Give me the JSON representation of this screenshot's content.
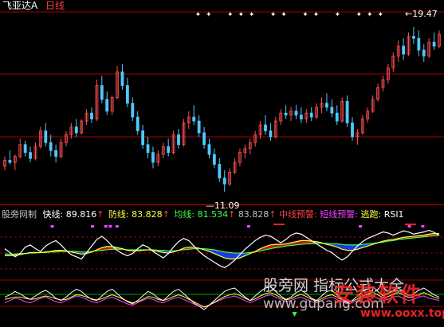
{
  "header": {
    "title": "飞亚达A",
    "period": "日线"
  },
  "price_labels": {
    "high": "19.47",
    "low": "11.09"
  },
  "indicator": {
    "name": "股旁网制",
    "fast_label": "快线:",
    "fast_value": "89.816",
    "defense_label": "防线:",
    "defense_value": "83.828",
    "mean_label": "均线:",
    "mean_value": "81.534",
    "extra_value": "83.828",
    "mid_warn": "中线预警:",
    "short_warn": "短线预警:",
    "escape": "逃跑:",
    "rsi": "RSI1"
  },
  "watermark": {
    "text1": "股旁网 指标公式大全",
    "text2": "www.gupang.com",
    "text3": "安装软件",
    "text4": "www.ooxx.top"
  },
  "colors": {
    "up": "#ff5050",
    "down": "#50c8ff",
    "fast": "#ffffff",
    "defense": "#ffff40",
    "mean": "#40ff40",
    "red_fill": "#d02020",
    "blue_fill": "#2040ff",
    "magenta": "#ff40ff",
    "axis_red": "#a00000"
  },
  "chart_data": {
    "type": "candlestick",
    "ylim": [
      10.5,
      20.2
    ],
    "high_label_value": 19.47,
    "low_label_value": 11.09,
    "candles": [
      [
        12.4,
        12.9,
        12.2,
        12.7
      ],
      [
        12.7,
        13.2,
        12.5,
        12.6
      ],
      [
        12.6,
        13.0,
        12.2,
        12.9
      ],
      [
        12.9,
        13.8,
        12.8,
        13.5
      ],
      [
        13.5,
        13.7,
        12.9,
        13.1
      ],
      [
        13.1,
        13.4,
        12.6,
        12.8
      ],
      [
        12.8,
        13.6,
        12.7,
        13.4
      ],
      [
        13.4,
        14.4,
        13.3,
        14.2
      ],
      [
        14.2,
        14.6,
        13.4,
        13.6
      ],
      [
        13.6,
        14.0,
        12.9,
        13.2
      ],
      [
        13.2,
        13.5,
        12.6,
        12.9
      ],
      [
        12.9,
        13.8,
        12.8,
        13.6
      ],
      [
        13.6,
        14.2,
        13.4,
        14.0
      ],
      [
        14.0,
        14.6,
        13.8,
        14.4
      ],
      [
        14.4,
        14.8,
        13.9,
        14.1
      ],
      [
        14.1,
        14.8,
        14.0,
        14.7
      ],
      [
        14.7,
        15.3,
        14.5,
        15.1
      ],
      [
        15.1,
        15.4,
        14.6,
        14.8
      ],
      [
        14.8,
        16.8,
        14.7,
        16.5
      ],
      [
        16.5,
        17.0,
        15.6,
        15.8
      ],
      [
        15.8,
        16.2,
        15.0,
        15.2
      ],
      [
        15.2,
        16.0,
        15.0,
        15.9
      ],
      [
        15.9,
        17.5,
        15.8,
        17.2
      ],
      [
        17.2,
        17.6,
        16.3,
        16.5
      ],
      [
        16.5,
        16.9,
        15.4,
        15.6
      ],
      [
        15.6,
        15.9,
        14.7,
        14.9
      ],
      [
        14.9,
        15.2,
        14.0,
        14.2
      ],
      [
        14.2,
        14.5,
        13.3,
        13.5
      ],
      [
        13.5,
        13.9,
        12.8,
        13.1
      ],
      [
        13.1,
        13.4,
        12.3,
        12.6
      ],
      [
        12.6,
        13.2,
        12.4,
        13.0
      ],
      [
        13.0,
        13.6,
        12.8,
        13.4
      ],
      [
        13.4,
        13.8,
        12.9,
        13.1
      ],
      [
        13.1,
        14.2,
        13.0,
        14.0
      ],
      [
        14.0,
        14.3,
        13.3,
        13.5
      ],
      [
        13.5,
        14.8,
        13.4,
        14.6
      ],
      [
        14.6,
        15.2,
        14.3,
        14.9
      ],
      [
        14.9,
        15.5,
        14.5,
        14.7
      ],
      [
        14.7,
        15.0,
        13.9,
        14.1
      ],
      [
        14.1,
        14.4,
        13.3,
        13.5
      ],
      [
        13.5,
        13.8,
        12.8,
        13.0
      ],
      [
        13.0,
        13.3,
        12.3,
        12.5
      ],
      [
        12.5,
        12.8,
        11.6,
        11.8
      ],
      [
        11.8,
        12.2,
        11.09,
        11.5
      ],
      [
        11.5,
        12.3,
        11.4,
        12.1
      ],
      [
        12.1,
        12.8,
        12.0,
        12.6
      ],
      [
        12.6,
        13.3,
        12.4,
        13.1
      ],
      [
        13.1,
        13.5,
        12.8,
        13.3
      ],
      [
        13.3,
        13.8,
        13.0,
        13.6
      ],
      [
        13.6,
        14.2,
        13.4,
        14.0
      ],
      [
        14.0,
        14.7,
        13.8,
        14.5
      ],
      [
        14.5,
        15.0,
        14.0,
        14.2
      ],
      [
        14.2,
        14.6,
        13.7,
        13.9
      ],
      [
        13.9,
        14.9,
        13.8,
        14.7
      ],
      [
        14.7,
        15.3,
        14.5,
        15.1
      ],
      [
        15.1,
        15.5,
        14.8,
        15.0
      ],
      [
        15.0,
        15.4,
        14.7,
        15.2
      ],
      [
        15.2,
        15.5,
        14.8,
        15.0
      ],
      [
        15.0,
        15.4,
        14.6,
        14.8
      ],
      [
        14.8,
        15.3,
        14.6,
        15.1
      ],
      [
        15.1,
        15.4,
        14.7,
        14.9
      ],
      [
        14.9,
        15.6,
        14.8,
        15.4
      ],
      [
        15.4,
        15.9,
        15.1,
        15.6
      ],
      [
        15.6,
        16.1,
        15.2,
        15.4
      ],
      [
        15.4,
        15.8,
        14.9,
        15.1
      ],
      [
        15.1,
        15.5,
        14.5,
        14.7
      ],
      [
        14.7,
        15.9,
        14.6,
        15.7
      ],
      [
        15.7,
        16.0,
        14.4,
        14.6
      ],
      [
        14.6,
        14.9,
        13.7,
        13.9
      ],
      [
        13.9,
        14.3,
        13.5,
        14.1
      ],
      [
        14.1,
        15.0,
        14.0,
        14.8
      ],
      [
        14.8,
        15.4,
        14.6,
        15.2
      ],
      [
        15.2,
        16.0,
        15.1,
        15.8
      ],
      [
        15.8,
        16.6,
        15.7,
        16.4
      ],
      [
        16.4,
        17.0,
        16.2,
        16.8
      ],
      [
        16.8,
        17.6,
        16.6,
        17.4
      ],
      [
        17.4,
        18.2,
        17.2,
        18.0
      ],
      [
        18.0,
        18.8,
        17.7,
        18.5
      ],
      [
        18.5,
        18.9,
        17.8,
        18.1
      ],
      [
        18.1,
        19.2,
        18.0,
        19.0
      ],
      [
        19.0,
        19.47,
        18.6,
        18.9
      ],
      [
        18.9,
        19.3,
        18.0,
        18.3
      ],
      [
        18.3,
        18.6,
        17.7,
        18.0
      ],
      [
        18.0,
        18.9,
        17.9,
        18.7
      ],
      [
        18.7,
        19.2,
        18.3,
        18.5
      ],
      [
        18.5,
        19.3,
        18.4,
        19.1
      ]
    ],
    "upper_markers": [
      18,
      19,
      21,
      22,
      23,
      25,
      26,
      28,
      29,
      31,
      33,
      34,
      35
    ],
    "fast_line": [
      55,
      48,
      40,
      46,
      58,
      62,
      55,
      50,
      60,
      66,
      70,
      62,
      52,
      44,
      40,
      36,
      48,
      60,
      72,
      78,
      70,
      60,
      52,
      46,
      42,
      46,
      55,
      62,
      58,
      50,
      44,
      38,
      46,
      58,
      68,
      74,
      70,
      60,
      50,
      42,
      36,
      30,
      24,
      20,
      26,
      34,
      44,
      54,
      62,
      70,
      76,
      80,
      78,
      72,
      66,
      72,
      80,
      84,
      82,
      76,
      70,
      64,
      58,
      52,
      48,
      40,
      34,
      40,
      50,
      60,
      68,
      74,
      78,
      82,
      86,
      84,
      80,
      84,
      88,
      86,
      82,
      84,
      86,
      89,
      85,
      80
    ],
    "defense_line": [
      42,
      42,
      43,
      44,
      46,
      48,
      48,
      48,
      49,
      50,
      52,
      52,
      51,
      49,
      47,
      45,
      46,
      49,
      53,
      57,
      59,
      59,
      57,
      55,
      52,
      51,
      51,
      52,
      53,
      52,
      50,
      48,
      47,
      49,
      52,
      56,
      58,
      58,
      56,
      53,
      50,
      46,
      42,
      38,
      36,
      36,
      38,
      42,
      46,
      50,
      55,
      59,
      62,
      63,
      63,
      64,
      66,
      68,
      70,
      70,
      69,
      68,
      66,
      63,
      61,
      58,
      54,
      52,
      52,
      54,
      57,
      60,
      63,
      66,
      69,
      71,
      72,
      74,
      76,
      77,
      78,
      79,
      80,
      82,
      83,
      83
    ],
    "mean_line": [
      45,
      45,
      45,
      46,
      46,
      47,
      47,
      48,
      48,
      49,
      49,
      50,
      50,
      50,
      50,
      49,
      49,
      50,
      51,
      52,
      53,
      54,
      54,
      54,
      53,
      53,
      53,
      53,
      53,
      53,
      52,
      52,
      51,
      51,
      52,
      53,
      54,
      55,
      55,
      55,
      54,
      53,
      51,
      49,
      48,
      47,
      47,
      47,
      48,
      49,
      51,
      53,
      55,
      57,
      58,
      60,
      61,
      62,
      63,
      64,
      64,
      65,
      65,
      65,
      64,
      64,
      63,
      62,
      62,
      62,
      63,
      64,
      65,
      66,
      67,
      69,
      70,
      72,
      73,
      74,
      75,
      76,
      77,
      78,
      79,
      80
    ],
    "lower_pink": [
      30,
      34,
      38,
      36,
      32,
      30,
      34,
      38,
      40,
      36,
      32,
      30,
      34,
      38,
      42,
      40,
      36,
      32,
      30,
      34,
      38,
      40,
      36,
      32,
      28,
      26,
      30,
      34,
      38,
      36,
      32,
      30,
      34,
      38,
      40,
      36,
      32,
      28,
      24,
      22,
      26,
      30,
      34,
      38,
      40,
      42,
      38,
      34,
      30,
      34,
      38,
      42,
      44,
      40,
      36,
      32,
      34,
      38,
      40,
      36,
      32,
      30,
      34,
      38,
      40,
      36,
      32,
      28,
      30,
      34,
      38,
      40,
      42,
      38,
      34,
      36,
      40,
      42,
      38,
      34,
      36,
      40,
      42,
      38,
      36,
      34
    ],
    "lower_white": [
      40,
      44,
      50,
      46,
      40,
      36,
      42,
      48,
      52,
      46,
      38,
      34,
      40,
      48,
      54,
      50,
      42,
      36,
      34,
      42,
      50,
      54,
      46,
      38,
      32,
      28,
      34,
      42,
      50,
      46,
      38,
      34,
      42,
      50,
      54,
      46,
      38,
      30,
      24,
      18,
      26,
      34,
      42,
      50,
      54,
      56,
      48,
      40,
      34,
      42,
      50,
      56,
      58,
      50,
      42,
      36,
      40,
      48,
      52,
      46,
      38,
      34,
      42,
      50,
      52,
      44,
      36,
      30,
      34,
      42,
      50,
      54,
      58,
      50,
      42,
      46,
      52,
      56,
      50,
      42,
      46,
      52,
      56,
      50,
      44,
      40
    ],
    "lower_yellow": [
      36,
      38,
      40,
      40,
      38,
      36,
      37,
      40,
      42,
      40,
      37,
      35,
      36,
      40,
      44,
      43,
      40,
      37,
      35,
      37,
      41,
      44,
      41,
      37,
      33,
      30,
      32,
      36,
      41,
      40,
      36,
      34,
      37,
      41,
      44,
      41,
      36,
      32,
      27,
      23,
      26,
      31,
      36,
      41,
      44,
      46,
      43,
      38,
      34,
      37,
      42,
      46,
      48,
      44,
      39,
      35,
      37,
      42,
      45,
      41,
      36,
      33,
      37,
      42,
      44,
      40,
      35,
      31,
      33,
      37,
      42,
      45,
      48,
      44,
      39,
      41,
      45,
      48,
      44,
      39,
      41,
      45,
      48,
      44,
      40,
      37
    ],
    "lower_green_markers": [
      21,
      41,
      61
    ]
  }
}
